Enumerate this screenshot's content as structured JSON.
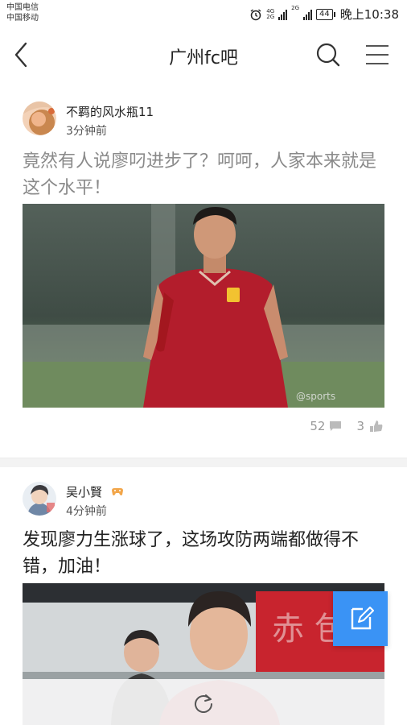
{
  "status_bar": {
    "carrier_1": "中国电信",
    "carrier_2": "中国移动",
    "net_1a": "4G",
    "net_1b": "2G",
    "net_2": "2G",
    "battery": "44",
    "time": "晚上10:38"
  },
  "nav": {
    "title": "广州fc吧"
  },
  "posts": [
    {
      "author": "不羁的风水瓶11",
      "time": "3分钟前",
      "title": "竟然有人说廖叼进步了？呵呵，人家本来就是这个水平！",
      "comments": "52",
      "likes": "3"
    },
    {
      "author": "吴小賢",
      "time": "4分钟前",
      "title": "发现廖力生涨球了，这场攻防两端都做得不错，加油！"
    }
  ],
  "colors": {
    "accent": "#3a93f5",
    "title_faded": "#8a8a8a",
    "title_normal": "#222222",
    "stat_gray": "#999999",
    "jersey_red": "#b31d2c"
  },
  "icons": [
    "back-arrow-icon",
    "search-icon",
    "menu-icon",
    "comment-icon",
    "like-icon",
    "edit-icon",
    "refresh-icon",
    "game-badge-icon"
  ]
}
